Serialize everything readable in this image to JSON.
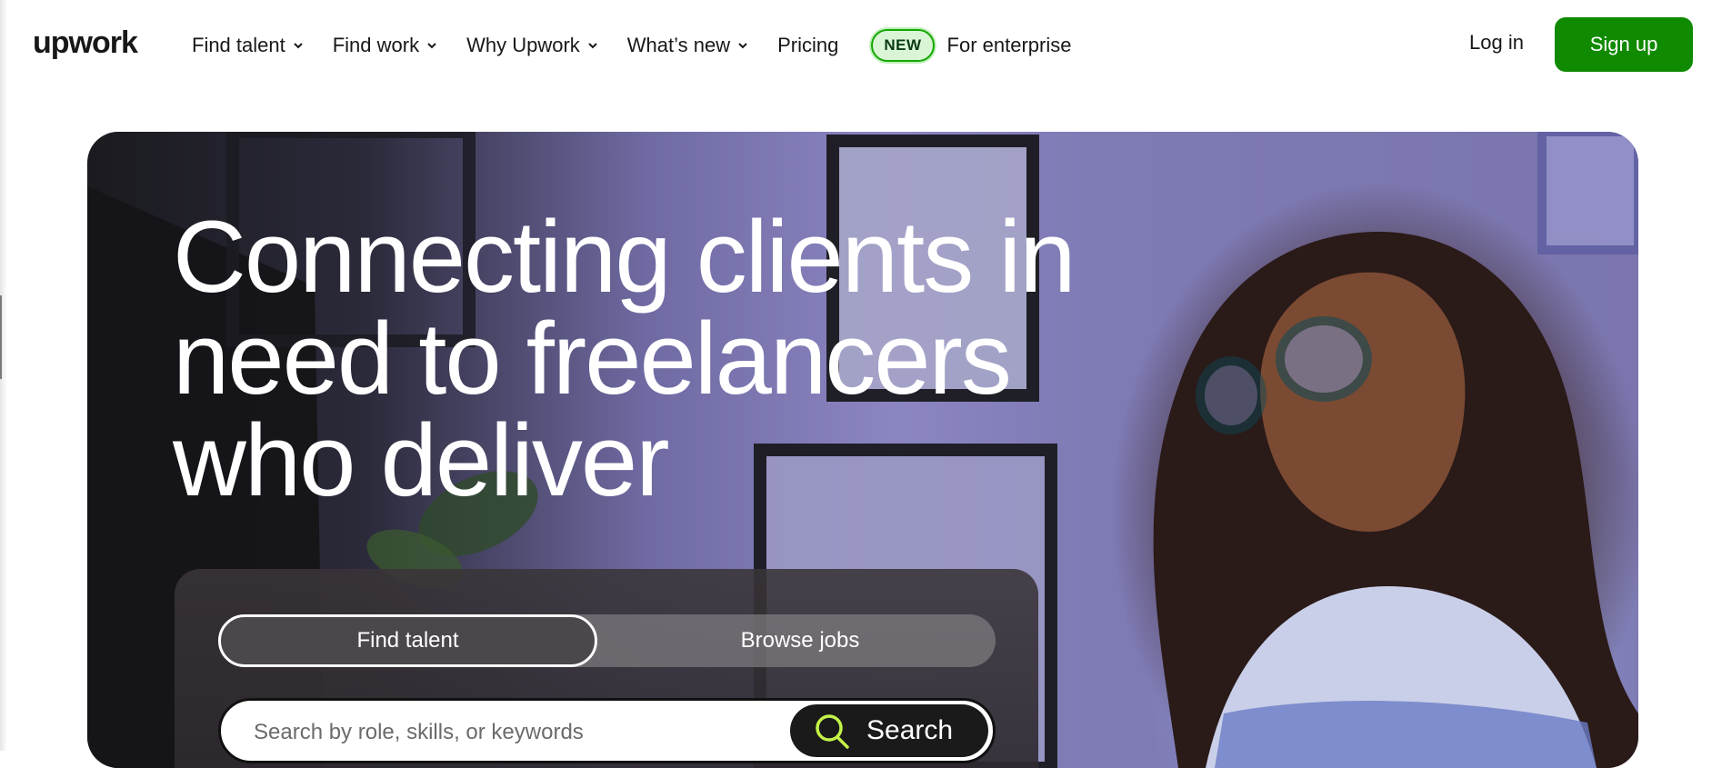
{
  "brand": {
    "logo_text": "upwork",
    "accent_color": "#108a00"
  },
  "header": {
    "nav": [
      {
        "label": "Find talent",
        "has_dropdown": true
      },
      {
        "label": "Find work",
        "has_dropdown": true
      },
      {
        "label": "Why Upwork",
        "has_dropdown": true
      },
      {
        "label": "What’s new",
        "has_dropdown": true
      },
      {
        "label": "Pricing",
        "has_dropdown": false
      }
    ],
    "badge": "NEW",
    "enterprise_label": "For enterprise",
    "login_label": "Log in",
    "signup_label": "Sign up"
  },
  "hero": {
    "headline_lines": [
      "Connecting clients in",
      "need to freelancers",
      "who deliver"
    ],
    "tabs": [
      {
        "label": "Find talent",
        "selected": true
      },
      {
        "label": "Browse jobs",
        "selected": false
      }
    ],
    "search": {
      "placeholder": "Search by role, skills, or keywords",
      "button_label": "Search",
      "icon": "search-icon"
    }
  }
}
